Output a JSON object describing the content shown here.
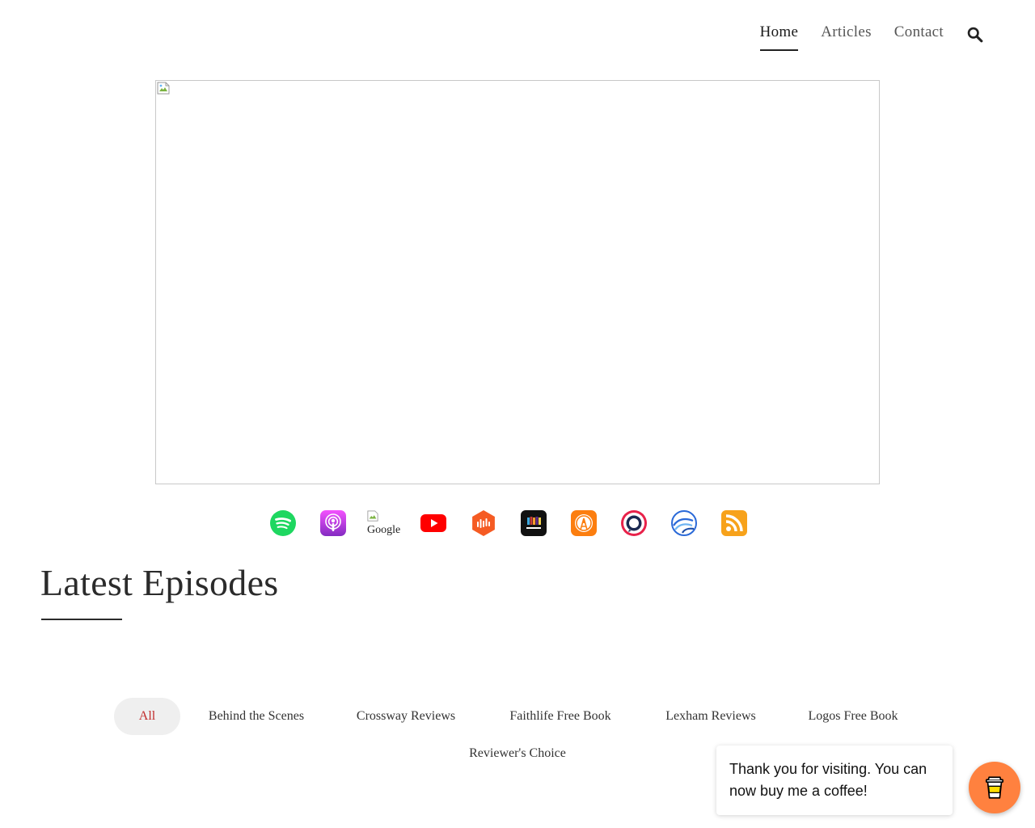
{
  "nav": {
    "items": [
      {
        "label": "Home",
        "active": true
      },
      {
        "label": "Articles",
        "active": false
      },
      {
        "label": "Contact",
        "active": false
      }
    ],
    "search_icon": "search-icon"
  },
  "hero": {
    "state": "broken-image"
  },
  "platforms": [
    {
      "name": "Spotify",
      "icon": "spotify-icon",
      "color": "#1ed760"
    },
    {
      "name": "Apple Podcasts",
      "icon": "apple-podcasts-icon",
      "color": "#9b4ee3"
    },
    {
      "name": "Google",
      "icon": "google-podcasts-broken-image",
      "alt_text": "Google"
    },
    {
      "name": "YouTube",
      "icon": "youtube-icon",
      "color": "#ff0000"
    },
    {
      "name": "Castbox",
      "icon": "castbox-icon",
      "color": "#f55b23"
    },
    {
      "name": "Stitcher",
      "icon": "stitcher-icon",
      "color": "#111111"
    },
    {
      "name": "Overcast",
      "icon": "overcast-icon",
      "color": "#fc7e0f"
    },
    {
      "name": "Pocket Casts",
      "icon": "pocket-casts-icon",
      "color": "#f43e37"
    },
    {
      "name": "Breaker",
      "icon": "breaker-icon",
      "color": "#2b6ad8"
    },
    {
      "name": "RSS",
      "icon": "rss-icon",
      "color": "#f7a21b"
    }
  ],
  "latest": {
    "title": "Latest Episodes"
  },
  "filters": [
    {
      "label": "All",
      "active": true
    },
    {
      "label": "Behind the Scenes",
      "active": false
    },
    {
      "label": "Crossway Reviews",
      "active": false
    },
    {
      "label": "Faithlife Free Book",
      "active": false
    },
    {
      "label": "Lexham Reviews",
      "active": false
    },
    {
      "label": "Logos Free Book",
      "active": false
    },
    {
      "label": "Reviewer's Choice",
      "active": false
    }
  ],
  "toast": {
    "message": "Thank you for visiting. You can now buy me a coffee!"
  },
  "coffee_button": {
    "icon": "coffee-cup-icon",
    "color": "#ff813f"
  },
  "colors": {
    "accent_filter": "#c12b2b",
    "text": "#2b2b2b"
  }
}
